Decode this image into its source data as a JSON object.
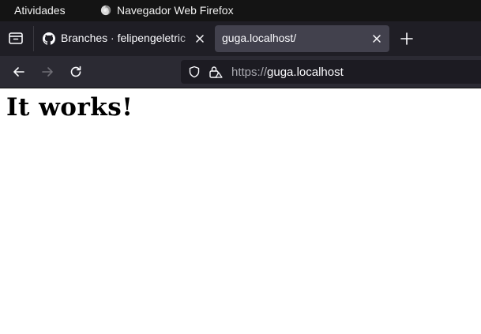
{
  "system_bar": {
    "activities_label": "Atividades",
    "app_name": "Navegador Web Firefox"
  },
  "tabs": [
    {
      "title": "Branches · felipengeletric",
      "icon": "github-icon",
      "active": false
    },
    {
      "title": "guga.localhost/",
      "icon": "",
      "active": true
    }
  ],
  "navigation": {
    "url_scheme": "https://",
    "url_host": "guga.localhost"
  },
  "page": {
    "heading": "It works!"
  },
  "colors": {
    "system_bar": "#141414",
    "tab_strip": "#1f1e25",
    "active_tab": "#42414d",
    "toolbar": "#2b2a33",
    "url_field": "#1c1b22",
    "page_background": "#ffffff"
  }
}
